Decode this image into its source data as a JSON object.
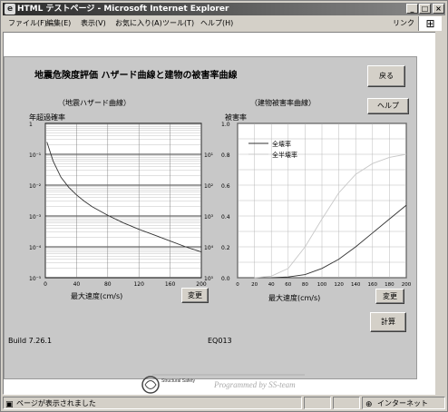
{
  "window": {
    "title": "HTML テストページ - Microsoft Internet Explorer",
    "min_label": "_",
    "max_label": "□",
    "close_label": "×"
  },
  "menu": {
    "items": [
      "ファイル(F)",
      "編集(E)",
      "表示(V)",
      "お気に入り(A)",
      "ツール(T)",
      "ヘルプ(H)"
    ],
    "link_label": "リンク"
  },
  "page": {
    "title": "地震危険度評価 ハザード曲線と建物の被害率曲線",
    "back_button": "戻る",
    "help_button": "ヘルプ",
    "calc_button": "計算",
    "build": "Build 7.26.1",
    "eq": "EQ013",
    "logo_text": "Structural Safety",
    "programmed_by": "Programmed by SS-team"
  },
  "status": {
    "message": "ページが表示されました",
    "zone": "インターネット"
  },
  "chart_data": [
    {
      "type": "line",
      "title": "（地震ハザード曲線）",
      "xlabel": "最大速度(cm/s)",
      "ylabel": "年超過確率",
      "yscale": "log",
      "xlim": [
        0,
        200
      ],
      "ylim": [
        1e-05,
        1
      ],
      "x_ticks": [
        "0",
        "40",
        "80",
        "120",
        "160",
        "200"
      ],
      "y_ticks_left": [
        "1",
        "10⁻¹",
        "10⁻²",
        "10⁻³",
        "10⁻⁴",
        "10⁻⁵"
      ],
      "y_ticks_right": [
        "10¹",
        "10²",
        "10³",
        "10⁴",
        "10⁵"
      ],
      "change_button": "変更",
      "series": [
        {
          "x": [
            2,
            10,
            20,
            30,
            40,
            50,
            60,
            80,
            100,
            120,
            140,
            160,
            180,
            200
          ],
          "y": [
            0.25,
            0.06,
            0.018,
            0.0085,
            0.0048,
            0.003,
            0.002,
            0.00105,
            0.0006,
            0.00037,
            0.00024,
            0.000155,
            0.0001,
            6.8e-05
          ]
        }
      ]
    },
    {
      "type": "line",
      "title": "（建物被害率曲線）",
      "xlabel": "最大速度(cm/s)",
      "ylabel": "被害率",
      "xlim": [
        0,
        200
      ],
      "ylim": [
        0,
        1.0
      ],
      "x_ticks": [
        "0",
        "20",
        "40",
        "60",
        "80",
        "100",
        "120",
        "140",
        "160",
        "180",
        "200"
      ],
      "y_ticks": [
        "0.0",
        "0.2",
        "0.4",
        "0.6",
        "0.8",
        "1.0"
      ],
      "change_button": "変更",
      "legend": "top-left",
      "series": [
        {
          "name": "全壊率",
          "color": "#333333",
          "x": [
            40,
            60,
            80,
            100,
            120,
            140,
            160,
            180,
            200
          ],
          "y": [
            0.0,
            0.005,
            0.02,
            0.06,
            0.12,
            0.2,
            0.29,
            0.38,
            0.47
          ]
        },
        {
          "name": "全半壊率",
          "color": "#c8c8c8",
          "x": [
            20,
            40,
            60,
            80,
            100,
            120,
            140,
            160,
            180,
            200
          ],
          "y": [
            0.0,
            0.01,
            0.06,
            0.2,
            0.38,
            0.55,
            0.67,
            0.74,
            0.78,
            0.8
          ]
        }
      ]
    }
  ]
}
